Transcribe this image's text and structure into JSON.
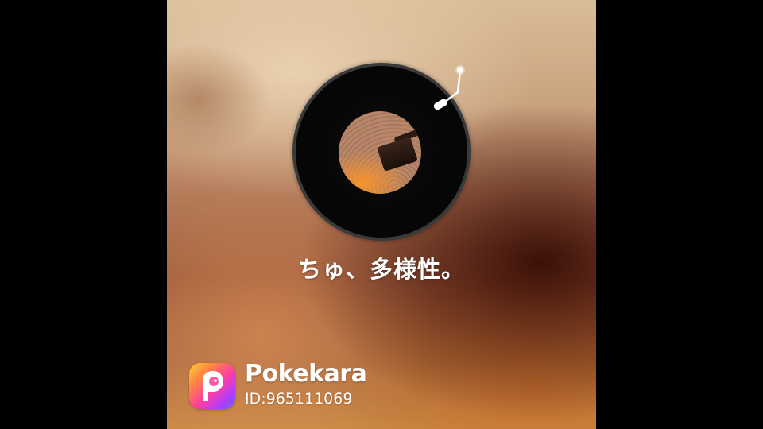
{
  "song": {
    "title": "ちゅ、多様性。"
  },
  "watermark": {
    "logo_icon": "pokekara-app-icon",
    "brand_name": "Pokekara",
    "user_id": "ID:965111069"
  },
  "player": {
    "record_icon": "vinyl-record-icon",
    "tonearm_icon": "tonearm-icon"
  },
  "colors": {
    "background": "#000000",
    "text": "#ffffff",
    "record": "#050505",
    "record_rim": "#3a3a3a"
  }
}
